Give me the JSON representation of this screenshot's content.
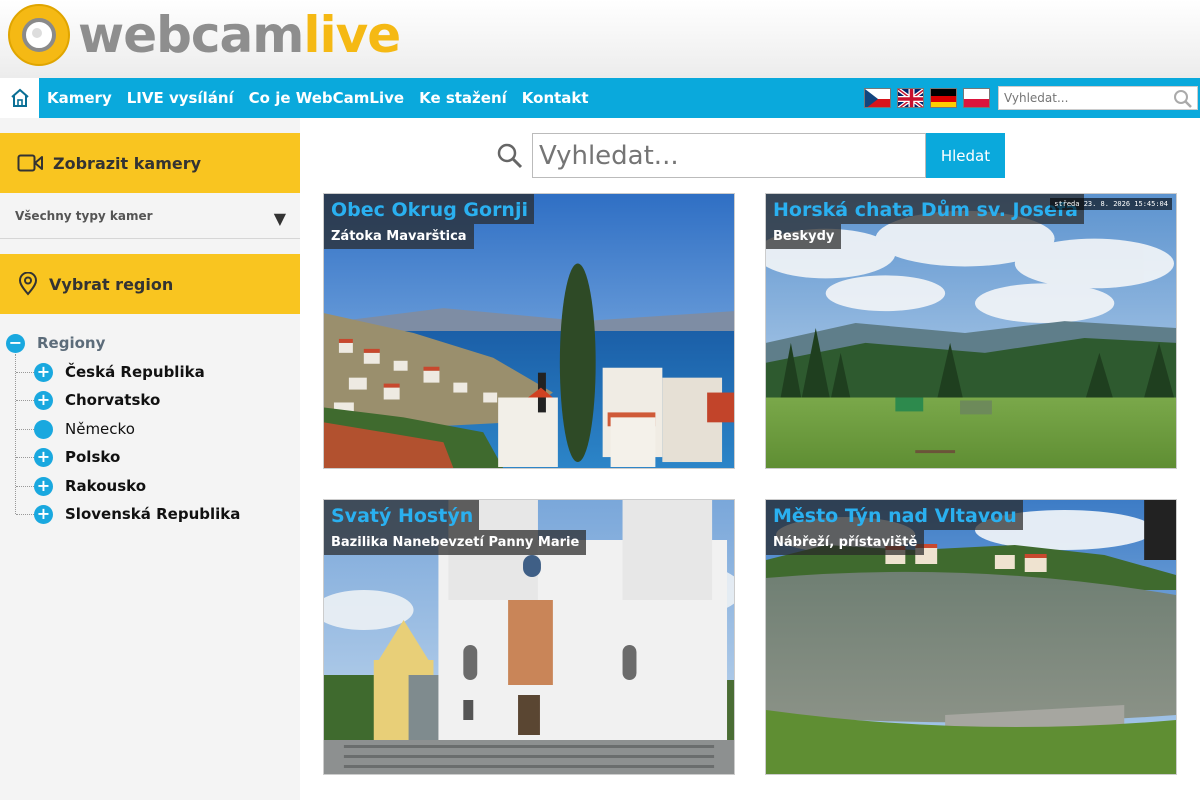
{
  "logo": {
    "part1": "webcam",
    "part2": "live"
  },
  "nav": {
    "items": [
      "Kamery",
      "LIVE vysílání",
      "Co je WebCamLive",
      "Ke stažení",
      "Kontakt"
    ],
    "search_placeholder": "Vyhledat..."
  },
  "sidebar": {
    "show_cameras": "Zobrazit kamery",
    "camera_type": "Všechny typy kamer",
    "select_region": "Vybrat region",
    "tree": {
      "root": "Regiony",
      "items": [
        {
          "label": "Česká Republika",
          "expandable": true
        },
        {
          "label": "Chorvatsko",
          "expandable": true
        },
        {
          "label": "Německo",
          "expandable": false
        },
        {
          "label": "Polsko",
          "expandable": true
        },
        {
          "label": "Rakousko",
          "expandable": true
        },
        {
          "label": "Slovenská Republika",
          "expandable": true
        }
      ]
    }
  },
  "main": {
    "search_placeholder": "Vyhledat...",
    "search_button": "Hledat",
    "cams": [
      {
        "title": "Obec Okrug Gornji",
        "subtitle": "Zátoka Mavarštica"
      },
      {
        "title": "Horská chata Dům sv. Josefa",
        "subtitle": "Beskydy",
        "stamp": "středa 23. 8. 2026 15:45:04"
      },
      {
        "title": "Svatý Hostýn",
        "subtitle": "Bazilika Nanebevzetí Panny Marie"
      },
      {
        "title": "Město Týn nad Vltavou",
        "subtitle": "Nábřeží, přístaviště"
      }
    ]
  },
  "colors": {
    "accent": "#0aa9dc",
    "yellow": "#f9c520",
    "title_blue": "#2ab0f0"
  }
}
